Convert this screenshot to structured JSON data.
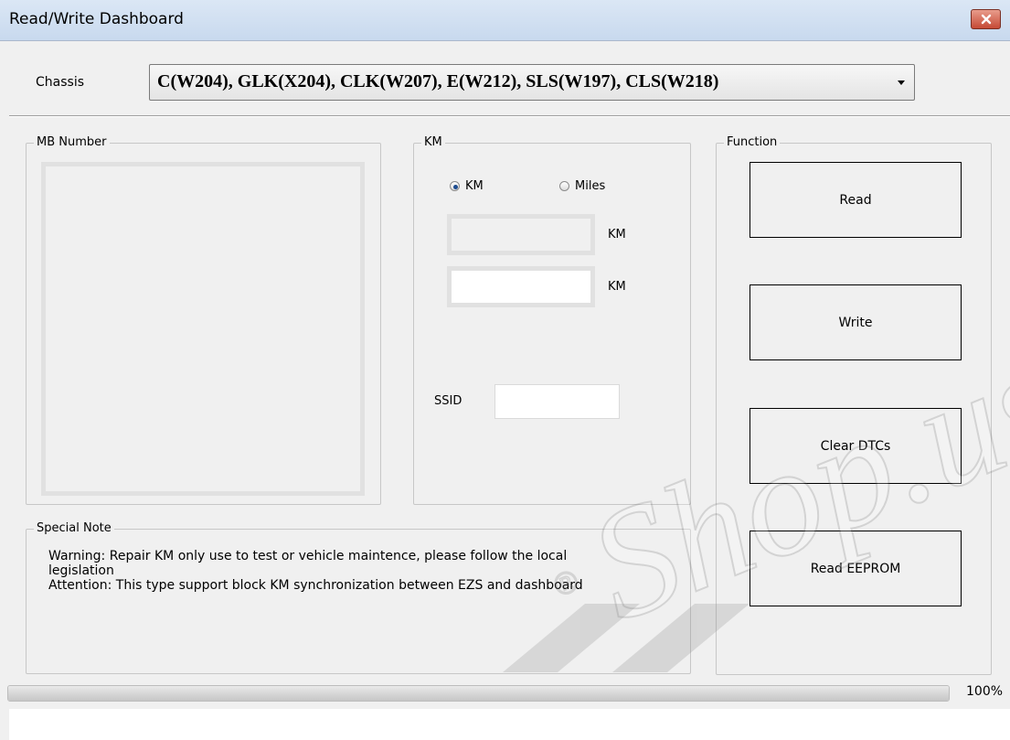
{
  "window": {
    "title": "Read/Write Dashboard",
    "close_icon": "close-icon"
  },
  "chassis": {
    "label": "Chassis",
    "selected": "C(W204), GLK(X204), CLK(W207), E(W212), SLS(W197), CLS(W218)"
  },
  "mb_number": {
    "legend": "MB Number"
  },
  "km": {
    "legend": "KM",
    "radio_km": "KM",
    "radio_miles": "Miles",
    "radio_selected": "KM",
    "unit_1": "KM",
    "unit_2": "KM",
    "value_1": "",
    "value_2": "",
    "ssid_label": "SSID",
    "ssid_value": ""
  },
  "function": {
    "legend": "Function",
    "read": "Read",
    "write": "Write",
    "clear_dtcs": "Clear DTCs",
    "read_eeprom": "Read EEPROM"
  },
  "note": {
    "legend": "Special Note",
    "line1": "Warning: Repair KM only use to test or vehicle maintence, please follow the local",
    "line2": "legislation",
    "line3": "Attention: This type support block KM synchronization between EZS and dashboard"
  },
  "progress": {
    "value": 1.0,
    "label": "100%"
  },
  "watermark": {
    "text": "Shop.us",
    "mark": "®"
  },
  "colors": {
    "titlebar": "#c8d9ee",
    "close": "#c54a35",
    "radio_dot": "#1c4b8f",
    "background": "#f0f0f0"
  }
}
